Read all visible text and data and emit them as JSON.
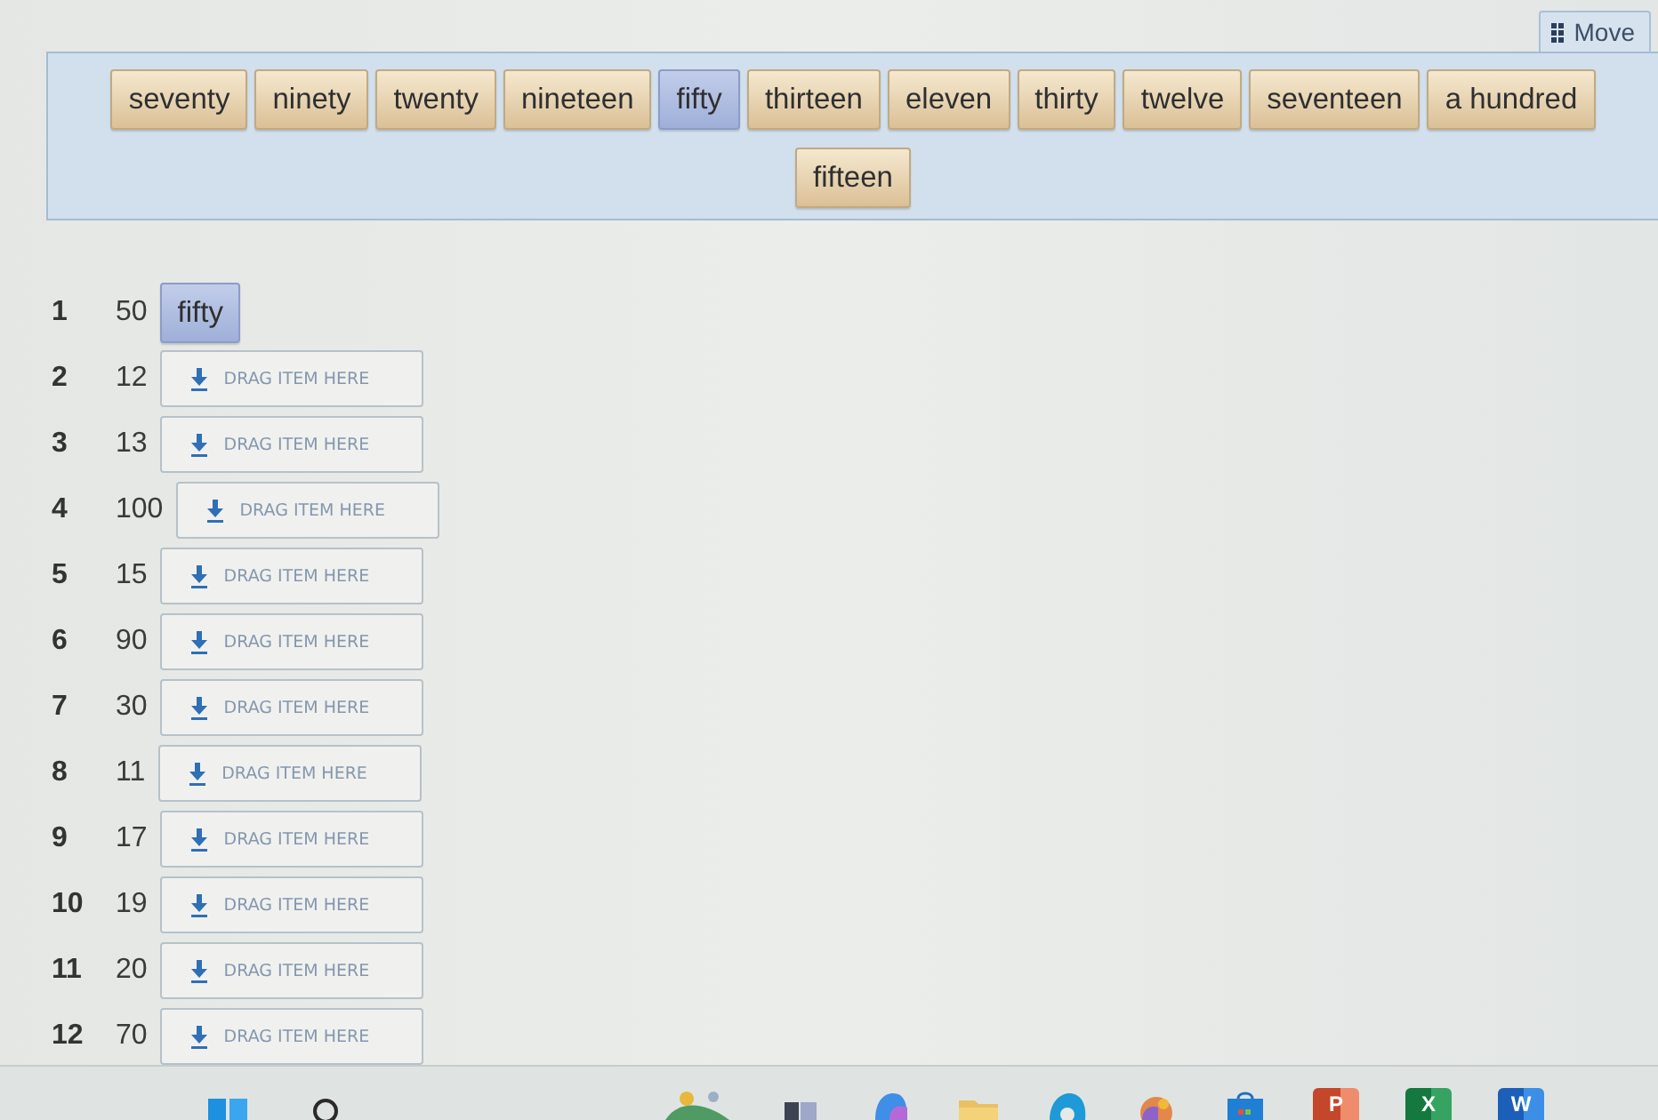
{
  "move_handle": {
    "label": "Move"
  },
  "bank": {
    "tiles": [
      {
        "label": "seventy",
        "used": false
      },
      {
        "label": "ninety",
        "used": false
      },
      {
        "label": "twenty",
        "used": false
      },
      {
        "label": "nineteen",
        "used": false
      },
      {
        "label": "fifty",
        "used": true
      },
      {
        "label": "thirteen",
        "used": false
      },
      {
        "label": "eleven",
        "used": false
      },
      {
        "label": "thirty",
        "used": false
      },
      {
        "label": "twelve",
        "used": false
      },
      {
        "label": "seventeen",
        "used": false
      },
      {
        "label": "a hundred",
        "used": false
      },
      {
        "label": "fifteen",
        "used": false
      }
    ]
  },
  "questions": [
    {
      "number": "1",
      "value": "50",
      "answer": "fifty"
    },
    {
      "number": "2",
      "value": "12",
      "placeholder": "DRAG ITEM HERE"
    },
    {
      "number": "3",
      "value": "13",
      "placeholder": "DRAG ITEM HERE"
    },
    {
      "number": "4",
      "value": "100",
      "placeholder": "DRAG ITEM HERE"
    },
    {
      "number": "5",
      "value": "15",
      "placeholder": "DRAG ITEM HERE"
    },
    {
      "number": "6",
      "value": "90",
      "placeholder": "DRAG ITEM HERE"
    },
    {
      "number": "7",
      "value": "30",
      "placeholder": "DRAG ITEM HERE"
    },
    {
      "number": "8",
      "value": "11",
      "placeholder": "DRAG ITEM HERE"
    },
    {
      "number": "9",
      "value": "17",
      "placeholder": "DRAG ITEM HERE"
    },
    {
      "number": "10",
      "value": "19",
      "placeholder": "DRAG ITEM HERE"
    },
    {
      "number": "11",
      "value": "20",
      "placeholder": "DRAG ITEM HERE"
    },
    {
      "number": "12",
      "value": "70",
      "placeholder": "DRAG ITEM HERE"
    }
  ],
  "taskbar": {
    "apps": [
      {
        "kind": "start"
      },
      {
        "kind": "search"
      },
      {
        "kind": "weather"
      },
      {
        "kind": "taskview"
      },
      {
        "kind": "assistant"
      },
      {
        "kind": "folder"
      },
      {
        "kind": "browser"
      },
      {
        "kind": "app"
      },
      {
        "kind": "store"
      },
      {
        "kind": "presentation",
        "letter": "P"
      },
      {
        "kind": "spreadsheet",
        "letter": "X"
      },
      {
        "kind": "document",
        "letter": "W"
      }
    ]
  }
}
